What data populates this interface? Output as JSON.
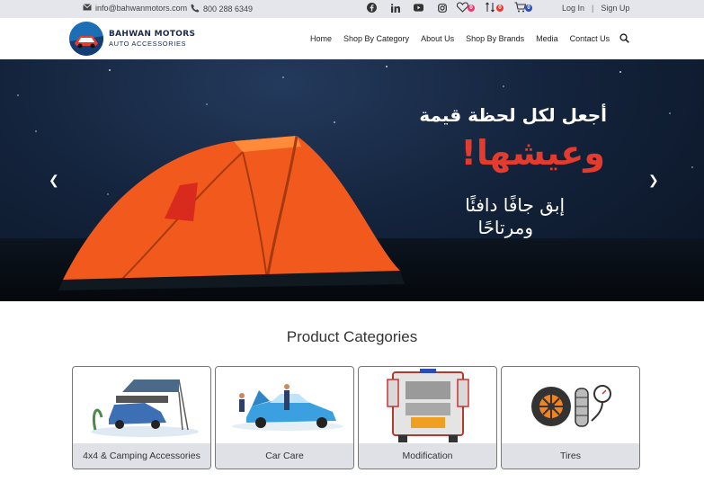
{
  "topbar": {
    "email": "info@bahwanmotors.com",
    "phone": "800 288 6349",
    "social": [
      "facebook-icon",
      "linkedin-icon",
      "youtube-icon",
      "instagram-icon"
    ],
    "wishlist_count": "0",
    "compare_count": "0",
    "cart_count": "0",
    "login_label": "Log In",
    "signup_label": "Sign Up"
  },
  "header": {
    "logo_line1": "BAHWAN MOTORS",
    "logo_line2": "AUTO ACCESSORIES",
    "nav": [
      "Home",
      "Shop By Category",
      "About Us",
      "Shop By Brands",
      "Media",
      "Contact Us"
    ]
  },
  "hero": {
    "line1": "أجعل لكل لحظة قيمة",
    "line2": "وعيشها!",
    "line3": "إبق جافًا دافئًا",
    "line4": "ومرتاحًا"
  },
  "categories": {
    "title": "Product Categories",
    "items": [
      {
        "label": "4x4 & Camping Accessories"
      },
      {
        "label": "Car Care"
      },
      {
        "label": "Modification"
      },
      {
        "label": "Tires"
      }
    ]
  },
  "colors": {
    "topbar_bg": "#e5e6eb",
    "tent": "#f2591c",
    "accent_red": "#e33b2e",
    "card_label_bg": "#dfe1e6",
    "brand_blue": "#1d6fb5"
  }
}
